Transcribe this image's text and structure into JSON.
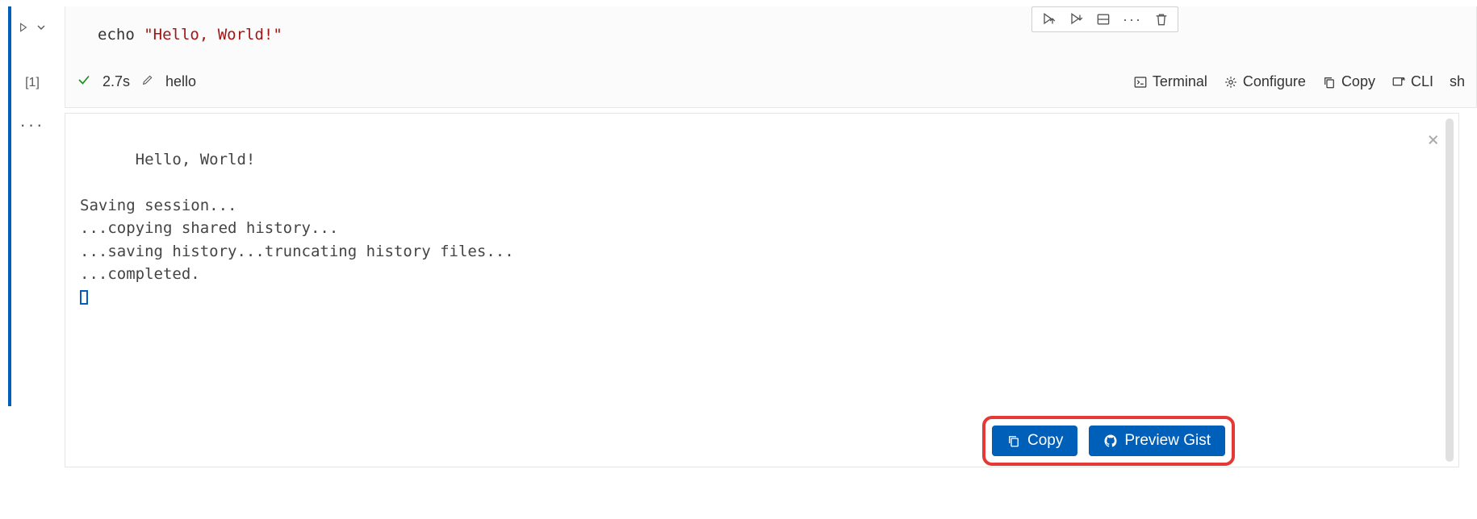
{
  "toolbar": {
    "run_above": "Run cells above",
    "run_below": "Run cells below",
    "split": "Split cell",
    "more": "···",
    "delete": "Delete cell"
  },
  "code_cell": {
    "execution_count": "[1]",
    "command": "echo",
    "string": "\"Hello, World!\""
  },
  "status": {
    "duration": "2.7s",
    "label": "hello",
    "terminal": "Terminal",
    "configure": "Configure",
    "copy": "Copy",
    "cli": "CLI",
    "lang": "sh"
  },
  "output": {
    "text": "Hello, World!\n\nSaving session...\n...copying shared history...\n...saving history...truncating history files...\n...completed."
  },
  "bottom": {
    "copy": "Copy",
    "preview_gist": "Preview Gist"
  }
}
